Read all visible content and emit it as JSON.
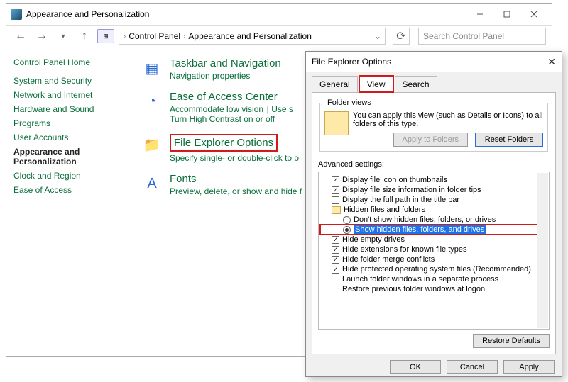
{
  "mainWindow": {
    "title": "Appearance and Personalization",
    "breadcrumb": {
      "seg1": "Control Panel",
      "seg2": "Appearance and Personalization"
    },
    "searchPlaceholder": "Search Control Panel"
  },
  "sidebar": {
    "head": "Control Panel Home",
    "items": [
      "System and Security",
      "Network and Internet",
      "Hardware and Sound",
      "Programs",
      "User Accounts",
      "Appearance and Personalization",
      "Clock and Region",
      "Ease of Access"
    ],
    "activeIndex": 5
  },
  "categories": [
    {
      "title": "Taskbar and Navigation",
      "links": [
        "Navigation properties"
      ]
    },
    {
      "title": "Ease of Access Center",
      "links": [
        "Accommodate low vision",
        "Use s",
        "Turn High Contrast on or off"
      ]
    },
    {
      "title": "File Explorer Options",
      "links": [
        "Specify single- or double-click to o"
      ],
      "highlight": true
    },
    {
      "title": "Fonts",
      "links": [
        "Preview, delete, or show and hide f"
      ]
    }
  ],
  "dialog": {
    "title": "File Explorer Options",
    "tabs": [
      "General",
      "View",
      "Search"
    ],
    "activeTab": 1,
    "folderViews": {
      "legend": "Folder views",
      "desc": "You can apply this view (such as Details or Icons) to all folders of this type.",
      "applyBtn": "Apply to Folders",
      "resetBtn": "Reset Folders"
    },
    "advLabel": "Advanced settings:",
    "tree": [
      {
        "type": "check",
        "checked": true,
        "label": "Display file icon on thumbnails",
        "indent": 1
      },
      {
        "type": "check",
        "checked": true,
        "label": "Display file size information in folder tips",
        "indent": 1
      },
      {
        "type": "check",
        "checked": false,
        "label": "Display the full path in the title bar",
        "indent": 1
      },
      {
        "type": "folder",
        "label": "Hidden files and folders",
        "indent": 1
      },
      {
        "type": "radio",
        "checked": false,
        "label": "Don't show hidden files, folders, or drives",
        "indent": 2
      },
      {
        "type": "radio",
        "checked": true,
        "label": "Show hidden files, folders, and drives",
        "indent": 2,
        "selected": true
      },
      {
        "type": "check",
        "checked": true,
        "label": "Hide empty drives",
        "indent": 1
      },
      {
        "type": "check",
        "checked": true,
        "label": "Hide extensions for known file types",
        "indent": 1
      },
      {
        "type": "check",
        "checked": true,
        "label": "Hide folder merge conflicts",
        "indent": 1
      },
      {
        "type": "check",
        "checked": true,
        "label": "Hide protected operating system files (Recommended)",
        "indent": 1
      },
      {
        "type": "check",
        "checked": false,
        "label": "Launch folder windows in a separate process",
        "indent": 1
      },
      {
        "type": "check",
        "checked": false,
        "label": "Restore previous folder windows at logon",
        "indent": 1
      }
    ],
    "restoreBtn": "Restore Defaults",
    "ok": "OK",
    "cancel": "Cancel",
    "apply": "Apply"
  }
}
